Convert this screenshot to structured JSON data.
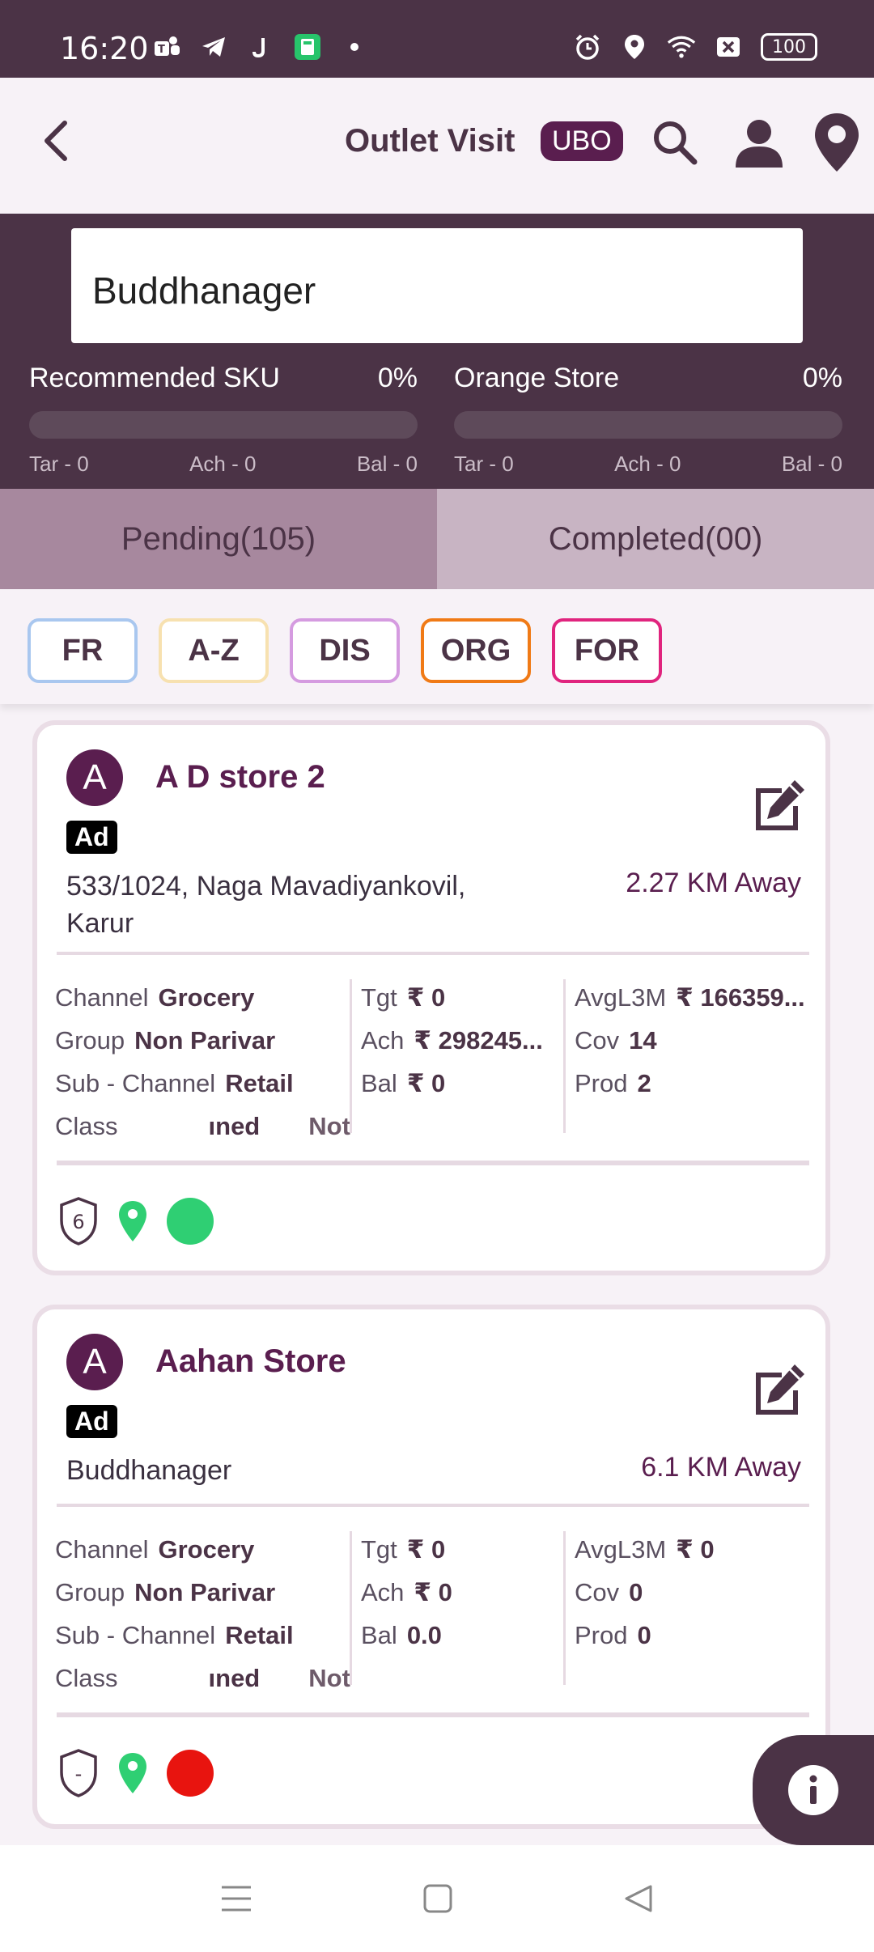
{
  "status_bar": {
    "time": "16:20",
    "battery": "100"
  },
  "header": {
    "title": "Outlet Visit",
    "badge": "UBO"
  },
  "location": {
    "value": "Buddhanager"
  },
  "metrics": [
    {
      "label": "Recommended SKU",
      "percent": "0%",
      "fill": 0,
      "tar": "Tar - 0",
      "ach": "Ach - 0",
      "bal": "Bal - 0"
    },
    {
      "label": "Orange Store",
      "percent": "0%",
      "fill": 0,
      "tar": "Tar - 0",
      "ach": "Ach - 0",
      "bal": "Bal - 0"
    }
  ],
  "tabs": {
    "pending": "Pending(105)",
    "completed": "Completed(00)"
  },
  "filters": [
    {
      "label": "FR",
      "color": "#a9c7ef"
    },
    {
      "label": "A-Z",
      "color": "#f7e1b0"
    },
    {
      "label": "DIS",
      "color": "#d59be0"
    },
    {
      "label": "ORG",
      "color": "#f07a16"
    },
    {
      "label": "FOR",
      "color": "#e0247e"
    }
  ],
  "outlets": [
    {
      "avatar": "A",
      "name": "A D store 2",
      "tag": "Ad",
      "address": "533/1024, Naga Mavadiyankovil, Karur",
      "distance": "2.27 KM Away",
      "labels": {
        "channel": "Channel",
        "group": "Group",
        "sub_channel": "Sub - Channel",
        "class": "Class",
        "tgt": "Tgt",
        "ach": "Ach",
        "bal": "Bal",
        "avg": "AvgL3M",
        "cov": "Cov",
        "prod": "Prod"
      },
      "channel": "Grocery",
      "group": "Non Parivar",
      "sub_channel": "Retail",
      "class_a": "ıned",
      "class_b": "Not",
      "tgt": "₹ 0",
      "ach": "₹ 298245...",
      "bal": "₹ 0",
      "avg": "₹ 166359...",
      "cov": "14",
      "prod": "2",
      "shield": "6",
      "status_color": "#2fcf73"
    },
    {
      "avatar": "A",
      "name": "Aahan Store",
      "tag": "Ad",
      "address": "Buddhanager",
      "distance": "6.1 KM Away",
      "labels": {
        "channel": "Channel",
        "group": "Group",
        "sub_channel": "Sub - Channel",
        "class": "Class",
        "tgt": "Tgt",
        "ach": "Ach",
        "bal": "Bal",
        "avg": "AvgL3M",
        "cov": "Cov",
        "prod": "Prod"
      },
      "channel": "Grocery",
      "group": "Non Parivar",
      "sub_channel": "Retail",
      "class_a": "ıned",
      "class_b": "Not",
      "tgt": "₹ 0",
      "ach": "₹ 0",
      "bal": "0.0",
      "avg": "₹ 0",
      "cov": "0",
      "prod": "0",
      "shield": "-",
      "status_color": "#e8140f"
    }
  ]
}
